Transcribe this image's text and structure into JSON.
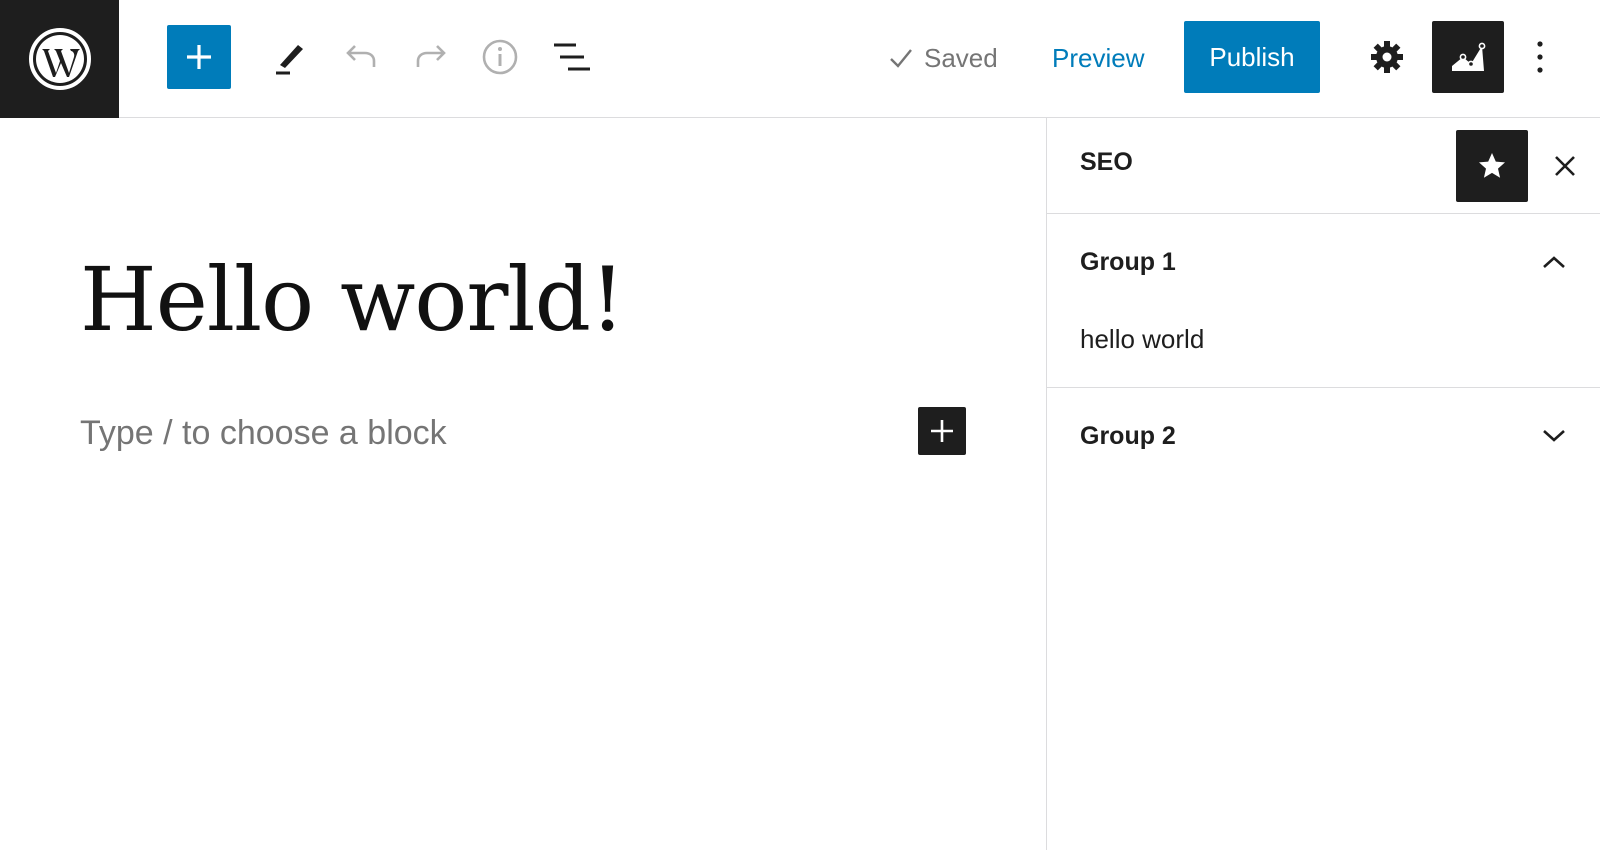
{
  "colors": {
    "accent": "#007cba",
    "dark": "#1e1e1e",
    "muted": "#757575",
    "border": "#dcdcde"
  },
  "toolbar": {
    "logo_icon": "wordpress-logo-icon",
    "inserter_icon": "plus-icon",
    "tools_icon": "pencil-icon",
    "undo_icon": "undo-icon",
    "redo_icon": "redo-icon",
    "details_icon": "info-icon",
    "list_view_icon": "list-view-icon",
    "saved_label": "Saved",
    "preview_label": "Preview",
    "publish_label": "Publish",
    "settings_icon": "gear-icon",
    "seo_plugin_icon": "chart-icon",
    "options_icon": "more-vertical-icon"
  },
  "editor": {
    "title": "Hello world!",
    "placeholder": "Type / to choose a block",
    "add_block_icon": "plus-icon"
  },
  "sidebar": {
    "title": "SEO",
    "pin_icon": "star-icon",
    "close_icon": "close-icon",
    "panels": [
      {
        "title": "Group 1",
        "expanded": true,
        "content": "hello world",
        "toggle_icon": "chevron-up-icon"
      },
      {
        "title": "Group 2",
        "expanded": false,
        "toggle_icon": "chevron-down-icon"
      }
    ]
  }
}
